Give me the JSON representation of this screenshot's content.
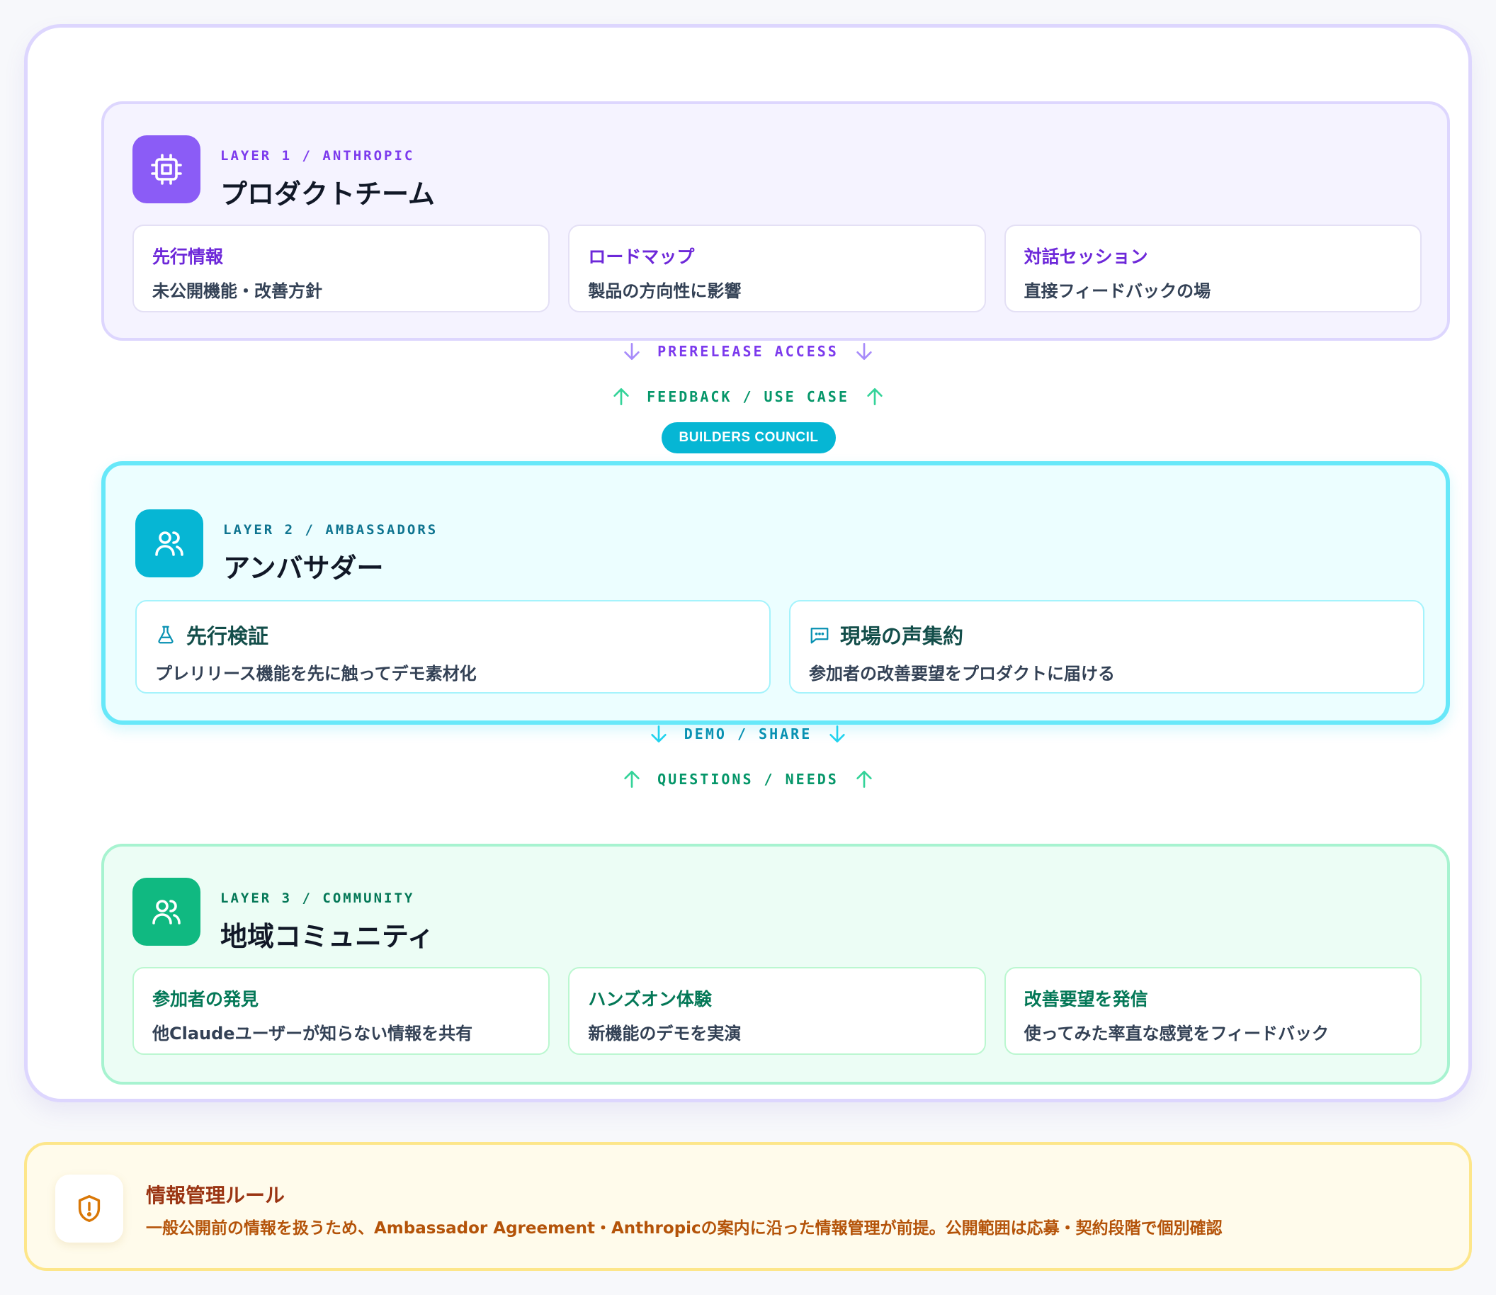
{
  "layers": {
    "layer1": {
      "kicker": "LAYER 1 / ANTHROPIC",
      "title": "プロダクトチーム",
      "icon": "chip-icon",
      "cards": [
        {
          "title": "先行情報",
          "desc": "未公開機能・改善方針"
        },
        {
          "title": "ロードマップ",
          "desc": "製品の方向性に影響"
        },
        {
          "title": "対話セッション",
          "desc": "直接フィードバックの場"
        }
      ]
    },
    "layer2": {
      "badge": "BUILDERS COUNCIL",
      "kicker": "LAYER 2 / AMBASSADORS",
      "title": "アンバサダー",
      "icon": "users-icon",
      "cards": [
        {
          "title": "先行検証",
          "desc": "プレリリース機能を先に触ってデモ素材化",
          "icon": "flask-icon"
        },
        {
          "title": "現場の声集約",
          "desc": "参加者の改善要望をプロダクトに届ける",
          "icon": "message-icon"
        }
      ]
    },
    "layer3": {
      "kicker": "LAYER 3 / COMMUNITY",
      "title": "地域コミュニティ",
      "icon": "users-icon",
      "cards": [
        {
          "title": "参加者の発見",
          "desc": "他Claudeユーザーが知らない情報を共有"
        },
        {
          "title": "ハンズオン体験",
          "desc": "新機能のデモを実演"
        },
        {
          "title": "改善要望を発信",
          "desc": "使ってみた率直な感覚をフィードバック"
        }
      ]
    }
  },
  "flows": {
    "down1": "PRERELEASE ACCESS",
    "up1": "FEEDBACK / USE CASE",
    "down2": "DEMO / SHARE",
    "up2": "QUESTIONS / NEEDS"
  },
  "rule": {
    "icon": "shield-alert-icon",
    "title": "情報管理ルール",
    "text": "一般公開前の情報を扱うため、Ambassador Agreement・Anthropicの案内に沿った情報管理が前提。公開範囲は応募・契約段階で個別確認"
  },
  "colors": {
    "layer1_accent": "#8b5cf6",
    "layer2_accent": "#06b6d4",
    "layer3_accent": "#10b981",
    "rule_accent": "#d97706"
  }
}
